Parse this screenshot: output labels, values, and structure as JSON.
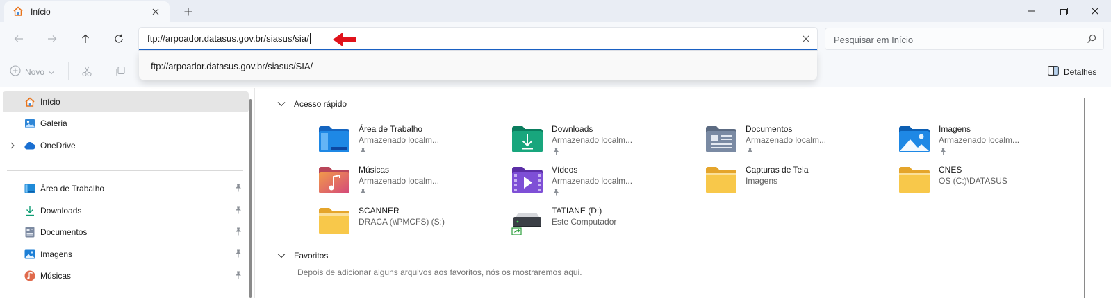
{
  "tab": {
    "title": "Início"
  },
  "address": {
    "value": "ftp://arpoador.datasus.gov.br/siasus/sia/",
    "suggestion": "ftp://arpoador.datasus.gov.br/siasus/SIA/"
  },
  "search": {
    "placeholder": "Pesquisar em Início"
  },
  "commandbar": {
    "new_label": "Novo",
    "details_label": "Detalhes"
  },
  "sidebar": {
    "top_items": [
      {
        "label": "Início",
        "icon": "home-icon"
      },
      {
        "label": "Galeria",
        "icon": "gallery-icon"
      },
      {
        "label": "OneDrive",
        "icon": "cloud-icon"
      }
    ],
    "pinned_items": [
      {
        "label": "Área de Trabalho",
        "icon": "desktop-icon"
      },
      {
        "label": "Downloads",
        "icon": "download-icon"
      },
      {
        "label": "Documentos",
        "icon": "document-icon"
      },
      {
        "label": "Imagens",
        "icon": "image-icon"
      },
      {
        "label": "Músicas",
        "icon": "music-icon"
      }
    ]
  },
  "main": {
    "quick_access_title": "Acesso rápido",
    "quick_access": [
      {
        "name": "Área de Trabalho",
        "sub": "Armazenado localm...",
        "pinned": true,
        "icon": "desktop-folder-icon"
      },
      {
        "name": "Downloads",
        "sub": "Armazenado localm...",
        "pinned": true,
        "icon": "downloads-folder-icon"
      },
      {
        "name": "Documentos",
        "sub": "Armazenado localm...",
        "pinned": true,
        "icon": "documents-folder-icon"
      },
      {
        "name": "Imagens",
        "sub": "Armazenado localm...",
        "pinned": true,
        "icon": "images-folder-icon"
      },
      {
        "name": "Músicas",
        "sub": "Armazenado localm...",
        "pinned": true,
        "icon": "music-folder-icon"
      },
      {
        "name": "Vídeos",
        "sub": "Armazenado localm...",
        "pinned": true,
        "icon": "videos-folder-icon"
      },
      {
        "name": "Capturas de Tela",
        "sub": "Imagens",
        "pinned": false,
        "icon": "folder-icon"
      },
      {
        "name": "CNES",
        "sub": "OS (C:)\\DATASUS",
        "pinned": false,
        "icon": "folder-icon"
      },
      {
        "name": "SCANNER",
        "sub": "DRACA (\\\\PMCFS) (S:)",
        "pinned": false,
        "icon": "folder-icon"
      },
      {
        "name": "TATIANE (D:)",
        "sub": "Este Computador",
        "pinned": false,
        "icon": "drive-icon"
      }
    ],
    "favorites_title": "Favoritos",
    "favorites_empty": "Depois de adicionar alguns arquivos aos favoritos, nós os mostraremos aqui."
  },
  "colors": {
    "accent": "#1a62c6",
    "arrow": "#e0121b",
    "folder_yellow": "#f8c84a"
  }
}
